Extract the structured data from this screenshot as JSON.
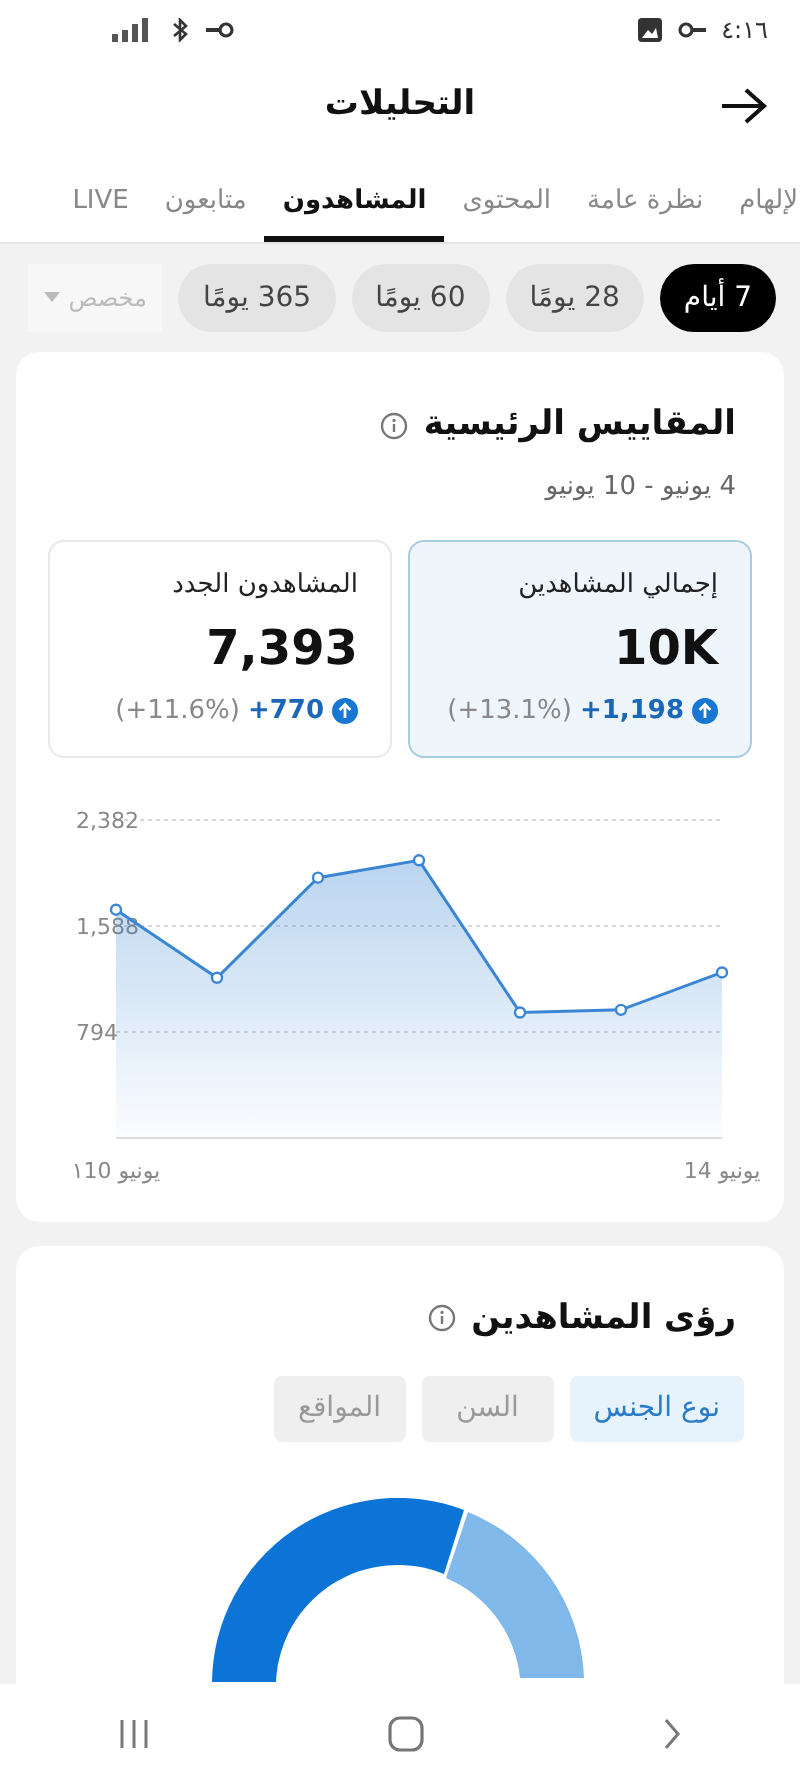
{
  "status_bar": {
    "time": "٤:١٦"
  },
  "header": {
    "title": "التحليلات"
  },
  "tabs": [
    {
      "label": "لإلهام",
      "selected": false
    },
    {
      "label": "نظرة عامة",
      "selected": false
    },
    {
      "label": "المحتوى",
      "selected": false
    },
    {
      "label": "المشاهدون",
      "selected": true
    },
    {
      "label": "متابعون",
      "selected": false
    },
    {
      "label": "LIVE",
      "selected": false
    }
  ],
  "ranges": [
    {
      "label": "7 أيام",
      "selected": true,
      "kind": "chip"
    },
    {
      "label": "28 يومًا",
      "selected": false,
      "kind": "chip"
    },
    {
      "label": "60 يومًا",
      "selected": false,
      "kind": "chip"
    },
    {
      "label": "365 يومًا",
      "selected": false,
      "kind": "chip"
    },
    {
      "label": "مخصص",
      "selected": false,
      "kind": "dropdown"
    }
  ],
  "key_metrics": {
    "title": "المقاييس الرئيسية",
    "date_range": "4 يونيو - 10 يونيو",
    "cards": [
      {
        "label": "إجمالي المشاهدين",
        "value": "10K",
        "change": "+1,198",
        "percent": "(+13.1%)",
        "selected": true
      },
      {
        "label": "المشاهدون الجدد",
        "value": "7,393",
        "change": "+770",
        "percent": "(+11.6%)",
        "selected": false
      }
    ],
    "chart_data": {
      "type": "area",
      "categories": [
        "يونيو ١10",
        null,
        null,
        null,
        null,
        null,
        "يونيو 14"
      ],
      "series": [
        {
          "color": "#3a86d4",
          "values": [
            1710,
            1200,
            1950,
            2080,
            940,
            960,
            1240
          ]
        }
      ],
      "ylim": [
        0,
        2382
      ],
      "yticks": [
        {
          "value": 794,
          "label": "794"
        },
        {
          "value": 1588,
          "label": "1,588"
        },
        {
          "value": 2382,
          "label": "2,382"
        }
      ]
    }
  },
  "insights": {
    "title": "رؤى المشاهدين",
    "tabs": [
      {
        "label": "نوع الجنس",
        "selected": true
      },
      {
        "label": "السن",
        "selected": false
      },
      {
        "label": "المواقع",
        "selected": false
      }
    ]
  }
}
